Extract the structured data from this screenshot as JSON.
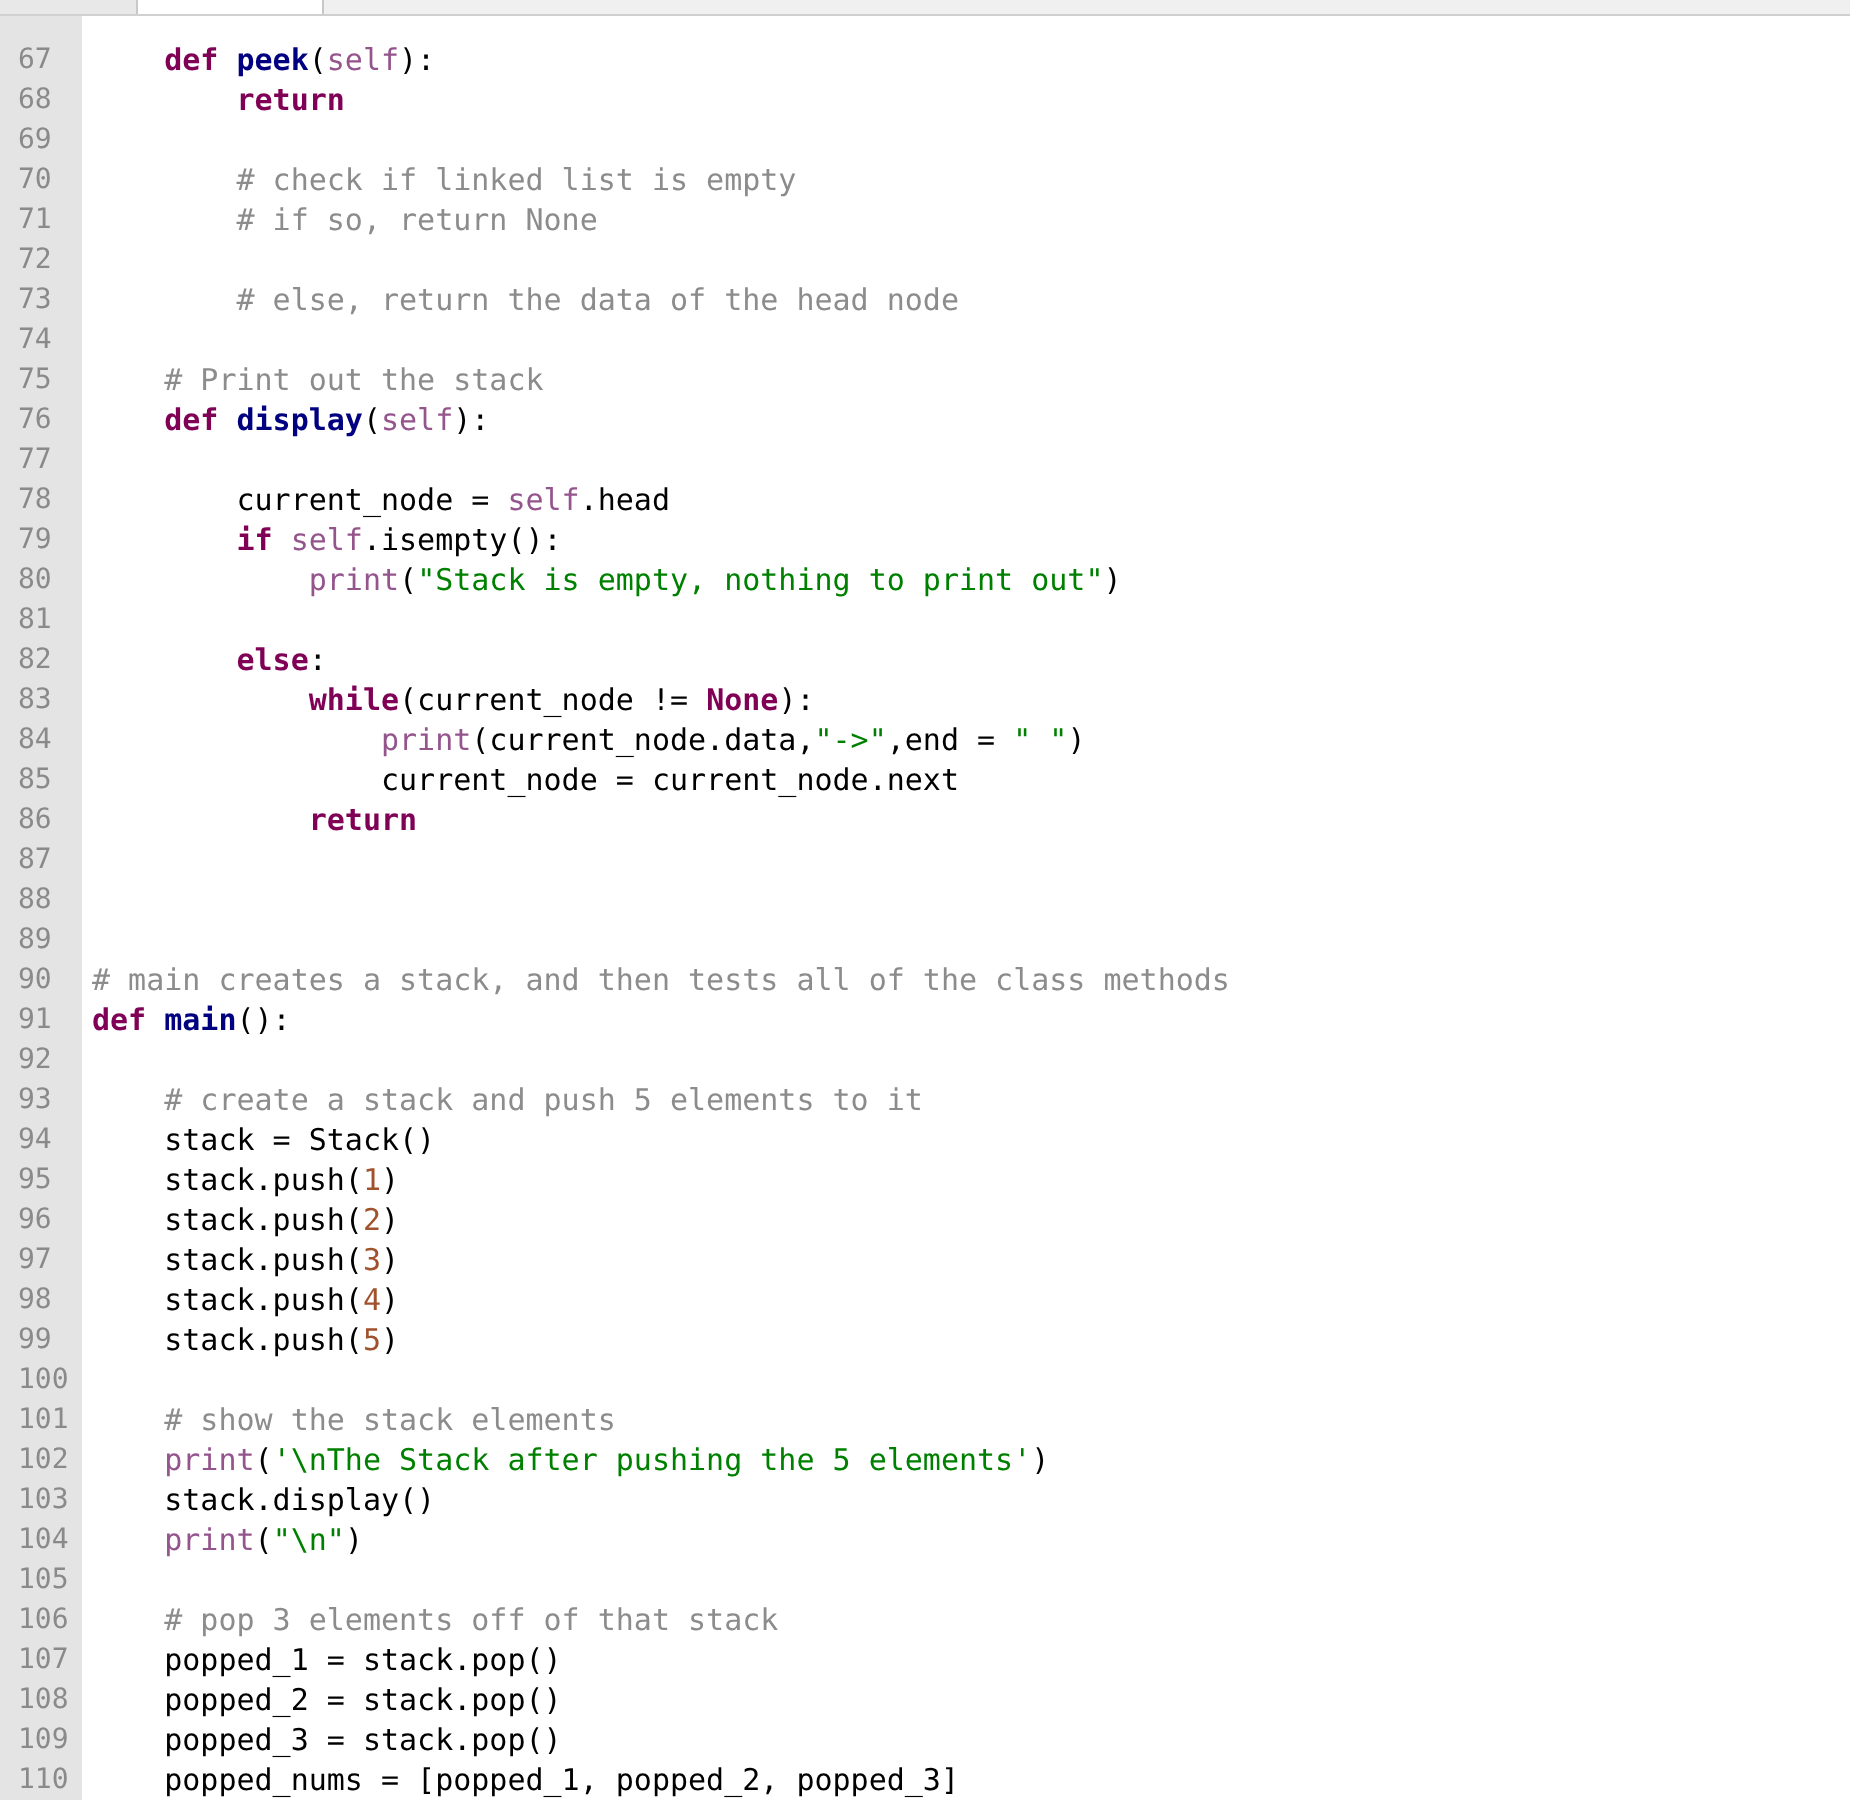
{
  "tabs": [
    {
      "selected": false
    },
    {
      "selected": true
    }
  ],
  "lines": [
    {
      "number": "67",
      "tokens": [
        {
          "kind": "keyword",
          "text": "    def"
        },
        {
          "kind": "function",
          "text": " peek"
        },
        {
          "kind": "plain",
          "text": "("
        },
        {
          "kind": "builtin",
          "text": "self"
        },
        {
          "kind": "plain",
          "text": "):"
        }
      ]
    },
    {
      "number": "68",
      "tokens": [
        {
          "kind": "keyword",
          "text": "        return"
        }
      ]
    },
    {
      "number": "69"
    },
    {
      "number": "70",
      "tokens": [
        {
          "kind": "comment",
          "text": "        # check if linked list is empty"
        }
      ]
    },
    {
      "number": "71",
      "tokens": [
        {
          "kind": "comment",
          "text": "        # if so, return None"
        }
      ]
    },
    {
      "number": "72"
    },
    {
      "number": "73",
      "tokens": [
        {
          "kind": "comment",
          "text": "        # else, return the data of the head node"
        }
      ]
    },
    {
      "number": "74"
    },
    {
      "number": "75",
      "tokens": [
        {
          "kind": "comment",
          "text": "    # Print out the stack"
        }
      ]
    },
    {
      "number": "76",
      "tokens": [
        {
          "kind": "keyword",
          "text": "    def"
        },
        {
          "kind": "function",
          "text": " display"
        },
        {
          "kind": "plain",
          "text": "("
        },
        {
          "kind": "builtin",
          "text": "self"
        },
        {
          "kind": "plain",
          "text": "):"
        }
      ]
    },
    {
      "number": "77"
    },
    {
      "number": "78",
      "tokens": [
        {
          "kind": "plain",
          "text": "        current_node = "
        },
        {
          "kind": "builtin",
          "text": "self"
        },
        {
          "kind": "plain",
          "text": ".head"
        }
      ]
    },
    {
      "number": "79",
      "tokens": [
        {
          "kind": "keyword",
          "text": "        if"
        },
        {
          "kind": "builtin",
          "text": " self"
        },
        {
          "kind": "plain",
          "text": ".isempty():"
        }
      ]
    },
    {
      "number": "80",
      "tokens": [
        {
          "kind": "builtin",
          "text": "            print"
        },
        {
          "kind": "plain",
          "text": "("
        },
        {
          "kind": "string",
          "text": "\"Stack is empty, nothing to print out\""
        },
        {
          "kind": "plain",
          "text": ")"
        }
      ]
    },
    {
      "number": "81"
    },
    {
      "number": "82",
      "tokens": [
        {
          "kind": "keyword",
          "text": "        else"
        },
        {
          "kind": "plain",
          "text": ":"
        }
      ]
    },
    {
      "number": "83",
      "tokens": [
        {
          "kind": "keyword",
          "text": "            while"
        },
        {
          "kind": "plain",
          "text": "(current_node != "
        },
        {
          "kind": "keyword",
          "text": "None"
        },
        {
          "kind": "plain",
          "text": "):"
        }
      ]
    },
    {
      "number": "84",
      "tokens": [
        {
          "kind": "builtin",
          "text": "                print"
        },
        {
          "kind": "plain",
          "text": "(current_node.data,"
        },
        {
          "kind": "string",
          "text": "\"->\""
        },
        {
          "kind": "plain",
          "text": ",end = "
        },
        {
          "kind": "string",
          "text": "\" \""
        },
        {
          "kind": "plain",
          "text": ")"
        }
      ]
    },
    {
      "number": "85",
      "tokens": [
        {
          "kind": "plain",
          "text": "                current_node = current_node.next"
        }
      ]
    },
    {
      "number": "86",
      "tokens": [
        {
          "kind": "keyword",
          "text": "            return"
        }
      ]
    },
    {
      "number": "87"
    },
    {
      "number": "88"
    },
    {
      "number": "89"
    },
    {
      "number": "90",
      "tokens": [
        {
          "kind": "comment",
          "text": "# main creates a stack, and then tests all of the class methods"
        }
      ]
    },
    {
      "number": "91",
      "tokens": [
        {
          "kind": "keyword",
          "text": "def"
        },
        {
          "kind": "function",
          "text": " main"
        },
        {
          "kind": "plain",
          "text": "():"
        }
      ]
    },
    {
      "number": "92"
    },
    {
      "number": "93",
      "tokens": [
        {
          "kind": "comment",
          "text": "    # create a stack and push 5 elements to it"
        }
      ]
    },
    {
      "number": "94",
      "tokens": [
        {
          "kind": "plain",
          "text": "    stack = Stack()"
        }
      ]
    },
    {
      "number": "95",
      "tokens": [
        {
          "kind": "plain",
          "text": "    stack.push("
        },
        {
          "kind": "number",
          "text": "1"
        },
        {
          "kind": "plain",
          "text": ")"
        }
      ]
    },
    {
      "number": "96",
      "tokens": [
        {
          "kind": "plain",
          "text": "    stack.push("
        },
        {
          "kind": "number",
          "text": "2"
        },
        {
          "kind": "plain",
          "text": ")"
        }
      ]
    },
    {
      "number": "97",
      "tokens": [
        {
          "kind": "plain",
          "text": "    stack.push("
        },
        {
          "kind": "number",
          "text": "3"
        },
        {
          "kind": "plain",
          "text": ")"
        }
      ]
    },
    {
      "number": "98",
      "tokens": [
        {
          "kind": "plain",
          "text": "    stack.push("
        },
        {
          "kind": "number",
          "text": "4"
        },
        {
          "kind": "plain",
          "text": ")"
        }
      ]
    },
    {
      "number": "99",
      "tokens": [
        {
          "kind": "plain",
          "text": "    stack.push("
        },
        {
          "kind": "number",
          "text": "5"
        },
        {
          "kind": "plain",
          "text": ")"
        }
      ]
    },
    {
      "number": "100"
    },
    {
      "number": "101",
      "tokens": [
        {
          "kind": "comment",
          "text": "    # show the stack elements"
        }
      ]
    },
    {
      "number": "102",
      "tokens": [
        {
          "kind": "builtin",
          "text": "    print"
        },
        {
          "kind": "plain",
          "text": "("
        },
        {
          "kind": "string",
          "text": "'\\nThe Stack after pushing the 5 elements'"
        },
        {
          "kind": "plain",
          "text": ")"
        }
      ]
    },
    {
      "number": "103",
      "tokens": [
        {
          "kind": "plain",
          "text": "    stack.display()"
        }
      ]
    },
    {
      "number": "104",
      "tokens": [
        {
          "kind": "builtin",
          "text": "    print"
        },
        {
          "kind": "plain",
          "text": "("
        },
        {
          "kind": "string",
          "text": "\"\\n\""
        },
        {
          "kind": "plain",
          "text": ")"
        }
      ]
    },
    {
      "number": "105"
    },
    {
      "number": "106",
      "tokens": [
        {
          "kind": "comment",
          "text": "    # pop 3 elements off of that stack"
        }
      ]
    },
    {
      "number": "107",
      "tokens": [
        {
          "kind": "plain",
          "text": "    popped_1 = stack.pop()"
        }
      ]
    },
    {
      "number": "108",
      "tokens": [
        {
          "kind": "plain",
          "text": "    popped_2 = stack.pop()"
        }
      ]
    },
    {
      "number": "109",
      "tokens": [
        {
          "kind": "plain",
          "text": "    popped_3 = stack.pop()"
        }
      ]
    },
    {
      "number": "110",
      "tokens": [
        {
          "kind": "plain",
          "text": "    popped_nums = [popped_1, popped_2, popped_3]"
        }
      ]
    }
  ]
}
